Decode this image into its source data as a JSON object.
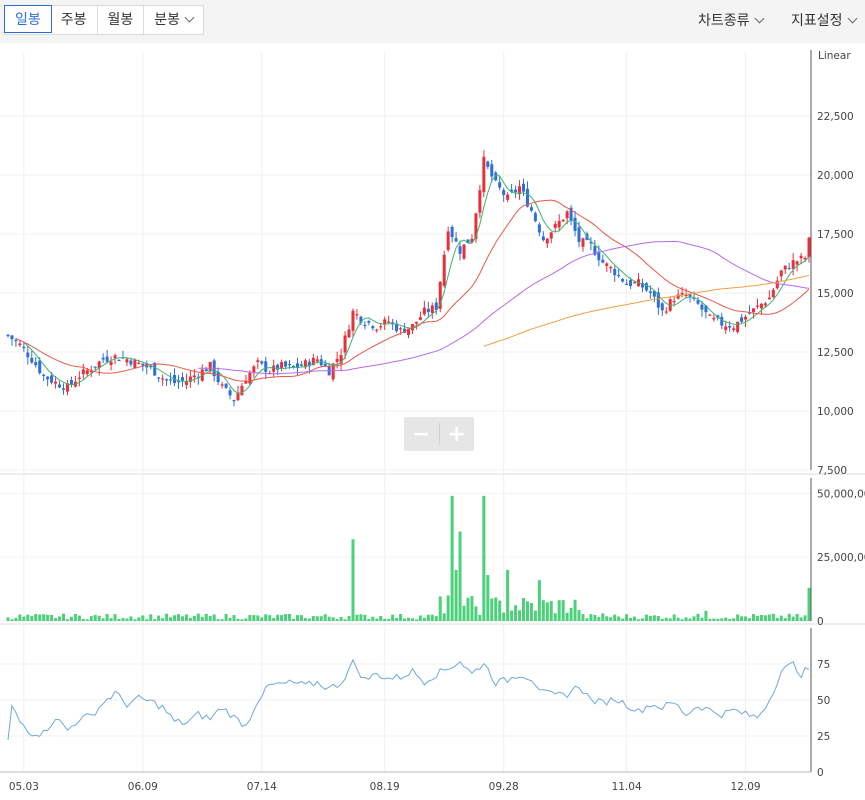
{
  "toolbar": {
    "tabs": [
      {
        "label": "일봉",
        "active": true
      },
      {
        "label": "주봉",
        "active": false
      },
      {
        "label": "월봉",
        "active": false
      },
      {
        "label": "분봉",
        "active": false
      }
    ],
    "chart_type_label": "차트종류",
    "indicator_label": "지표설정",
    "zoom_out": "−",
    "zoom_in": "+"
  },
  "colors": {
    "up": "#e8303a",
    "down": "#2f6fd8",
    "volume": "#4dd07a",
    "ma5": "#3cb371",
    "ma20": "#e85a4a",
    "ma60": "#b86ae8",
    "ma120": "#f0a040",
    "indicator": "#6fa8dc"
  },
  "chart_data": [
    {
      "type": "candlestick",
      "scale_label": "Linear",
      "ylim": [
        7500,
        23500
      ],
      "y_ticks": [
        "7,500",
        "10,000",
        "12,500",
        "15,000",
        "17,500",
        "20,000",
        "22,500"
      ],
      "x_ticks": [
        "05.03",
        "06.09",
        "07.14",
        "08.19",
        "09.28",
        "11.04",
        "12.09"
      ],
      "anchor_prices": [
        [
          0,
          13200
        ],
        [
          3,
          12800
        ],
        [
          6,
          12200
        ],
        [
          9,
          11500
        ],
        [
          12,
          11200
        ],
        [
          15,
          11000
        ],
        [
          18,
          11500
        ],
        [
          21,
          11800
        ],
        [
          24,
          12200
        ],
        [
          27,
          12300
        ],
        [
          30,
          12200
        ],
        [
          33,
          12000
        ],
        [
          36,
          11800
        ],
        [
          39,
          11400
        ],
        [
          42,
          11200
        ],
        [
          45,
          11300
        ],
        [
          48,
          11600
        ],
        [
          51,
          11900
        ],
        [
          54,
          11000
        ],
        [
          57,
          10500
        ],
        [
          60,
          11400
        ],
        [
          63,
          12000
        ],
        [
          66,
          11700
        ],
        [
          69,
          11900
        ],
        [
          72,
          11800
        ],
        [
          75,
          12000
        ],
        [
          78,
          12200
        ],
        [
          81,
          11700
        ],
        [
          84,
          12500
        ],
        [
          87,
          14200
        ],
        [
          90,
          13800
        ],
        [
          93,
          13600
        ],
        [
          96,
          13800
        ],
        [
          99,
          13400
        ],
        [
          102,
          13600
        ],
        [
          105,
          14200
        ],
        [
          108,
          14400
        ],
        [
          111,
          17800
        ],
        [
          114,
          16800
        ],
        [
          117,
          17400
        ],
        [
          120,
          20600
        ],
        [
          123,
          19600
        ],
        [
          126,
          19000
        ],
        [
          129,
          19500
        ],
        [
          132,
          18500
        ],
        [
          135,
          17300
        ],
        [
          138,
          17800
        ],
        [
          141,
          18400
        ],
        [
          144,
          17200
        ],
        [
          147,
          17000
        ],
        [
          150,
          16300
        ],
        [
          153,
          15900
        ],
        [
          156,
          15400
        ],
        [
          159,
          15400
        ],
        [
          162,
          15000
        ],
        [
          165,
          14200
        ],
        [
          168,
          14800
        ],
        [
          171,
          14900
        ],
        [
          174,
          14500
        ],
        [
          177,
          13900
        ],
        [
          180,
          13700
        ],
        [
          183,
          13600
        ],
        [
          186,
          14000
        ],
        [
          189,
          14400
        ],
        [
          192,
          14800
        ],
        [
          195,
          15900
        ],
        [
          198,
          16300
        ],
        [
          201,
          16500
        ],
        [
          202,
          17200
        ]
      ],
      "moving_averages": [
        "MA5",
        "MA20",
        "MA60",
        "MA120"
      ]
    },
    {
      "type": "bar",
      "name": "volume",
      "ylim": [
        0,
        56000000
      ],
      "y_ticks": [
        "0",
        "25,000,000",
        "50,000,000"
      ],
      "spikes": [
        {
          "index": 87,
          "value": 32000000
        },
        {
          "index": 111,
          "value": 10000000
        },
        {
          "index": 112,
          "value": 49000000
        },
        {
          "index": 113,
          "value": 20000000
        },
        {
          "index": 114,
          "value": 35000000
        },
        {
          "index": 120,
          "value": 49000000
        },
        {
          "index": 121,
          "value": 18000000
        },
        {
          "index": 126,
          "value": 20000000
        },
        {
          "index": 134,
          "value": 16000000
        },
        {
          "index": 150,
          "value": 3000000
        },
        {
          "index": 176,
          "value": 4000000
        },
        {
          "index": 202,
          "value": 13000000
        }
      ]
    },
    {
      "type": "line",
      "name": "indicator",
      "ylim": [
        0,
        85
      ],
      "y_ticks": [
        "0",
        "25",
        "50",
        "75"
      ],
      "anchor_values": [
        [
          0,
          22
        ],
        [
          1,
          45
        ],
        [
          3,
          35
        ],
        [
          6,
          27
        ],
        [
          9,
          27
        ],
        [
          12,
          38
        ],
        [
          15,
          29
        ],
        [
          18,
          37
        ],
        [
          21,
          39
        ],
        [
          24,
          48
        ],
        [
          27,
          55
        ],
        [
          30,
          47
        ],
        [
          33,
          51
        ],
        [
          36,
          49
        ],
        [
          39,
          45
        ],
        [
          42,
          35
        ],
        [
          45,
          34
        ],
        [
          48,
          40
        ],
        [
          51,
          37
        ],
        [
          54,
          45
        ],
        [
          57,
          38
        ],
        [
          60,
          32
        ],
        [
          63,
          50
        ],
        [
          66,
          60
        ],
        [
          69,
          61
        ],
        [
          72,
          62
        ],
        [
          75,
          60
        ],
        [
          78,
          62
        ],
        [
          81,
          58
        ],
        [
          84,
          62
        ],
        [
          87,
          76
        ],
        [
          90,
          64
        ],
        [
          93,
          68
        ],
        [
          96,
          65
        ],
        [
          99,
          66
        ],
        [
          102,
          70
        ],
        [
          105,
          63
        ],
        [
          108,
          68
        ],
        [
          111,
          72
        ],
        [
          114,
          77
        ],
        [
          117,
          68
        ],
        [
          120,
          76
        ],
        [
          123,
          62
        ],
        [
          126,
          64
        ],
        [
          129,
          68
        ],
        [
          132,
          65
        ],
        [
          135,
          55
        ],
        [
          138,
          53
        ],
        [
          141,
          54
        ],
        [
          144,
          60
        ],
        [
          147,
          50
        ],
        [
          150,
          48
        ],
        [
          153,
          51
        ],
        [
          156,
          47
        ],
        [
          159,
          42
        ],
        [
          162,
          47
        ],
        [
          165,
          45
        ],
        [
          168,
          48
        ],
        [
          171,
          40
        ],
        [
          174,
          46
        ],
        [
          177,
          43
        ],
        [
          180,
          40
        ],
        [
          183,
          43
        ],
        [
          186,
          40
        ],
        [
          189,
          38
        ],
        [
          192,
          50
        ],
        [
          195,
          70
        ],
        [
          198,
          75
        ],
        [
          200,
          68
        ],
        [
          202,
          72
        ]
      ]
    }
  ]
}
